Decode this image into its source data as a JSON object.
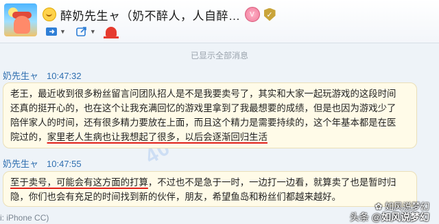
{
  "header": {
    "title": "醉奶先生ャ（奶不醉人，人自醉…",
    "vip_badge": "V",
    "shield_badge": "✓"
  },
  "toolbar": {
    "items": [
      "chat-transfer",
      "share",
      "alert"
    ]
  },
  "chat": {
    "system_message": "已显示全部消息",
    "messages": [
      {
        "sender": "奶先生ャ",
        "time": "10:47:32",
        "lines": [
          "老王，最近收到很多粉丝留言问团队招人是不是我要卖号了，其实和大家一起玩游戏的这段时间",
          "还真的挺开心的，也在这个让我充满回忆的游戏里拿到了我最想要的成绩，但是也因为游戏少了",
          "陪伴家人的时间，还有很多精力要放在上面，而且这个精力是需要持续的，这个年基本都是在医"
        ],
        "last_line_prefix": "院过的，",
        "last_line_highlight": "家里老人生病也让我想起了很多，以后会逐渐回归生活"
      },
      {
        "sender": "奶先生ャ",
        "time": "10:47:55",
        "line1_highlight": "至于卖号，可能会有这方面的打算",
        "line1_rest": "，不过也不是急于一时，一边打一边看，就算卖了也是暂时归",
        "line2": "隐，你们也会有充足的时间找到新的伙伴，朋友，希望鱼岛和粉丝们都越来越好。"
      }
    ],
    "partial_text": "i: iPhone CC)"
  },
  "watermark": {
    "overlay_text": "40",
    "line1": "如风说梦幻",
    "line2_prefix": "头条 @",
    "line2_name": "如风说梦幻"
  }
}
